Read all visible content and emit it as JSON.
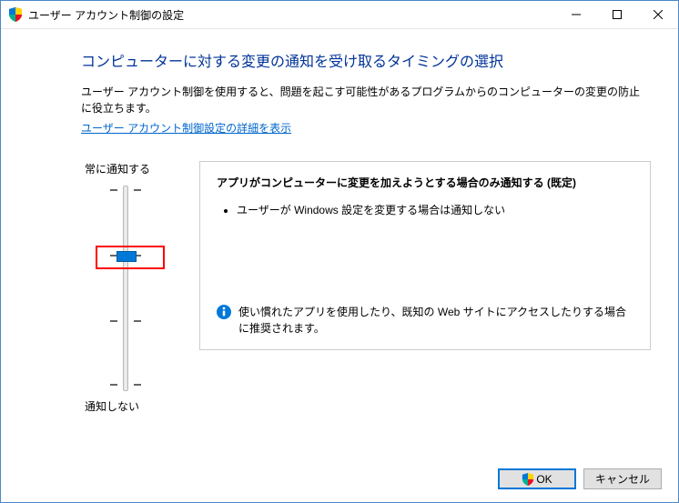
{
  "window": {
    "title": "ユーザー アカウント制御の設定"
  },
  "heading": "コンピューターに対する変更の通知を受け取るタイミングの選択",
  "description": "ユーザー アカウント制御を使用すると、問題を起こす可能性があるプログラムからのコンピューターの変更の防止に役立ちます。",
  "link_text": "ユーザー アカウント制御設定の詳細を表示",
  "slider": {
    "top_label": "常に通知する",
    "bottom_label": "通知しない",
    "levels": 4,
    "current_level": 2
  },
  "info": {
    "title": "アプリがコンピューターに変更を加えようとする場合のみ通知する (既定)",
    "bullets": [
      "ユーザーが Windows 設定を変更する場合は通知しない"
    ],
    "recommendation": "使い慣れたアプリを使用したり、既知の Web サイトにアクセスしたりする場合に推奨されます。"
  },
  "buttons": {
    "ok": "OK",
    "cancel": "キャンセル"
  }
}
